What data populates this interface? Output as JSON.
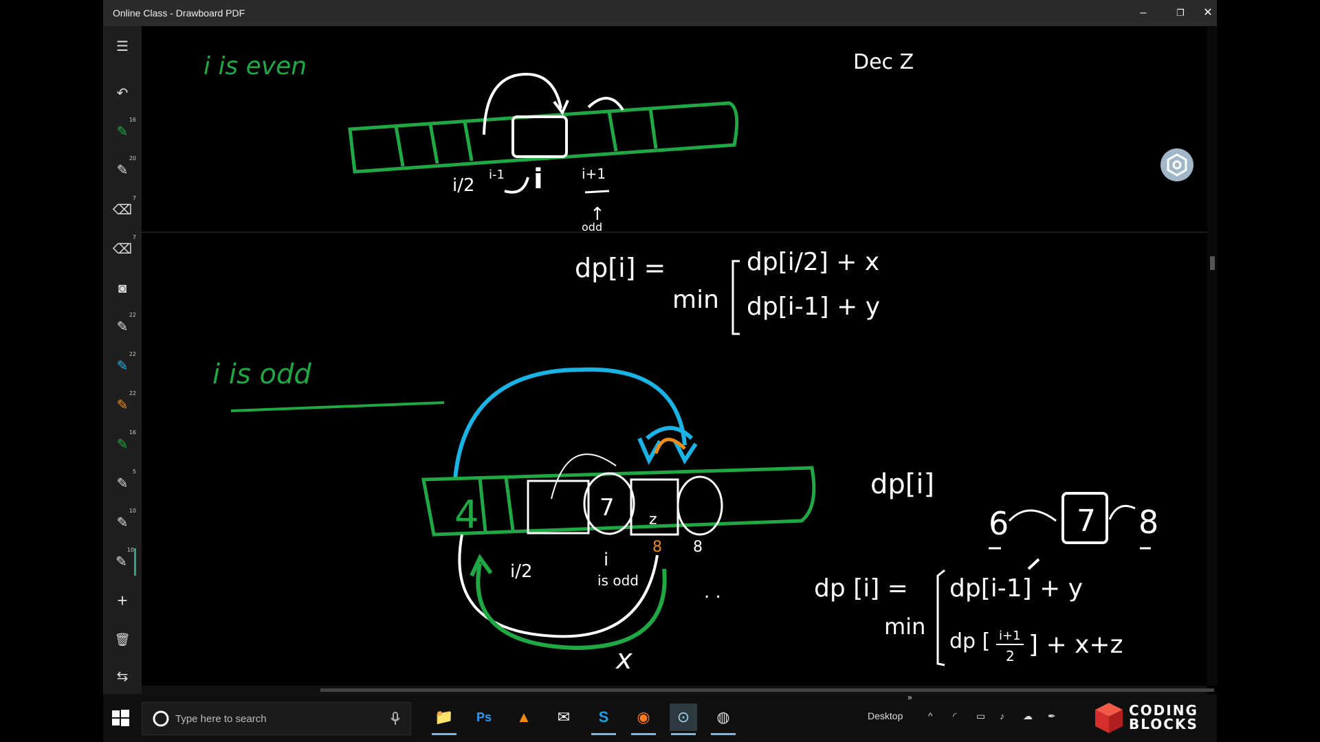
{
  "window": {
    "title": "Online Class - Drawboard PDF",
    "controls": {
      "minimize": "–",
      "restore": "❐",
      "close": "✕"
    }
  },
  "toolbar": {
    "tools": [
      {
        "name": "menu",
        "icon": "☰",
        "num": ""
      },
      {
        "name": "undo",
        "icon": "↶",
        "num": ""
      },
      {
        "name": "pen-green",
        "icon": "✎",
        "num": "16"
      },
      {
        "name": "pen-white",
        "icon": "✎",
        "num": "20"
      },
      {
        "name": "eraser",
        "icon": "⌫",
        "num": "7"
      },
      {
        "name": "eraser-2",
        "icon": "⌫",
        "num": "7"
      },
      {
        "name": "camera",
        "icon": "◙",
        "num": ""
      },
      {
        "name": "pen-white-2",
        "icon": "✎",
        "num": "22"
      },
      {
        "name": "pen-cyan",
        "icon": "✎",
        "num": "22"
      },
      {
        "name": "pen-orange",
        "icon": "✎",
        "num": "22"
      },
      {
        "name": "pen-green-2",
        "icon": "✎",
        "num": "16"
      },
      {
        "name": "pen-white-3",
        "icon": "✎",
        "num": "5"
      },
      {
        "name": "pen-white-4",
        "icon": "✎",
        "num": "10"
      },
      {
        "name": "pen-white-5",
        "icon": "✎",
        "num": "10"
      },
      {
        "name": "add",
        "icon": "+",
        "num": ""
      },
      {
        "name": "delete",
        "icon": "🗑",
        "num": ""
      },
      {
        "name": "swap",
        "icon": "⇆",
        "num": ""
      }
    ]
  },
  "canvas": {
    "colors": {
      "green": "#1fa843",
      "white": "#ffffff",
      "cyan": "#1ab3e6",
      "orange": "#f08a14"
    },
    "top": {
      "heading": "i    is    even",
      "dec_label": "Dec   Z",
      "labels": {
        "i_half": "i/2",
        "i_minus": "i-1",
        "i": "i",
        "i_plus": "i+1",
        "odd": "odd"
      }
    },
    "formula1": {
      "lhs": "dp[i]  =",
      "min": "min",
      "line1": "dp[i/2]  +  x",
      "line2": "dp[i-1]  +  y"
    },
    "bottom": {
      "heading": "i    is   odd",
      "cell_4": "4",
      "cell_7": "7",
      "cell_z": "z",
      "i_half": "i/2",
      "i_label": "i",
      "is_odd": "is odd",
      "eight_small": "8",
      "x_label": "x",
      "dots": ". ."
    },
    "right": {
      "dp_i": "dp[i]",
      "chain": {
        "a": "6",
        "b": "7",
        "c": "8"
      },
      "formula2": {
        "lhs": "dp [i]  =",
        "min": "min",
        "line1": "dp[i-1] + y",
        "line2_pre": "dp [",
        "line2_frac_num": "i+1",
        "line2_frac_den": "2",
        "line2_post": "] + x+z"
      }
    }
  },
  "taskbar": {
    "search_placeholder": "Type here to search",
    "desktop_label": "Desktop",
    "apps": [
      {
        "name": "file-explorer",
        "icon": "📁",
        "color": "#f2c233"
      },
      {
        "name": "photoshop",
        "icon": "Ps",
        "color": "#2d9bf0"
      },
      {
        "name": "vlc",
        "icon": "▲",
        "color": "#f08a14"
      },
      {
        "name": "mail",
        "icon": "✉",
        "color": "#ffffff"
      },
      {
        "name": "skype",
        "icon": "S",
        "color": "#1ea0e8"
      },
      {
        "name": "firefox",
        "icon": "◉",
        "color": "#ff7a1a"
      },
      {
        "name": "drawboard",
        "icon": "⊙",
        "color": "#9fd4e8"
      },
      {
        "name": "obs",
        "icon": "◍",
        "color": "#dddddd"
      }
    ],
    "logo": {
      "line1": "CODING",
      "line2": "BLOCKS"
    }
  }
}
